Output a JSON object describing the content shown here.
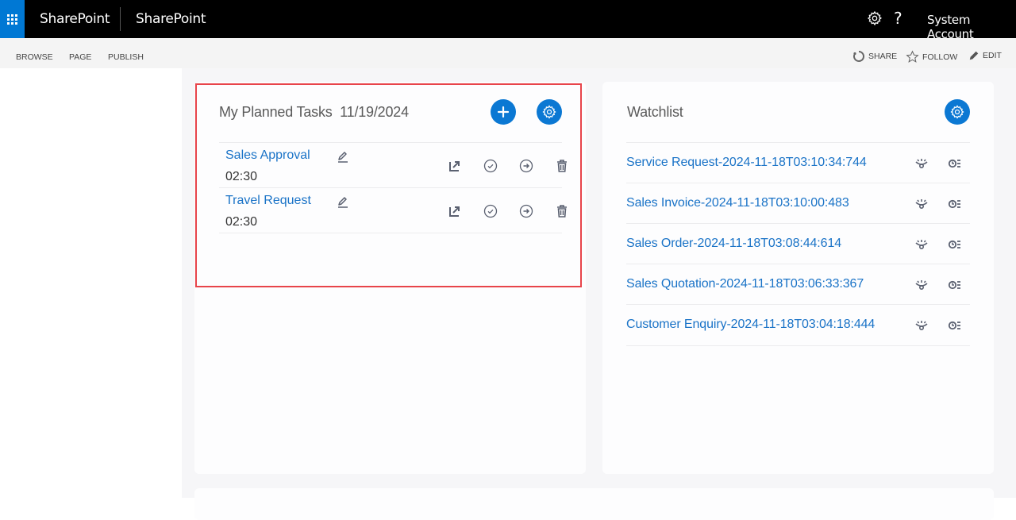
{
  "suitebar": {
    "app_launcher_icon": "waffle-icon",
    "brand": "SharePoint",
    "site_title": "SharePoint",
    "settings_icon": "gear-icon",
    "help_label": "?",
    "user": "System Account"
  },
  "ribbon": {
    "tabs": [
      {
        "label": "BROWSE"
      },
      {
        "label": "PAGE"
      },
      {
        "label": "PUBLISH"
      }
    ],
    "actions": [
      {
        "label": "SHARE",
        "icon": "share-icon"
      },
      {
        "label": "FOLLOW",
        "icon": "star-icon"
      },
      {
        "label": "EDIT",
        "icon": "pencil-icon"
      }
    ]
  },
  "planned_tasks": {
    "title": "My Planned Tasks",
    "date": "11/19/2024",
    "add_icon": "plus-icon",
    "settings_icon": "gear-icon",
    "tasks": [
      {
        "name": "Sales Approval",
        "time": "02:30"
      },
      {
        "name": "Travel Request",
        "time": "02:30"
      }
    ],
    "row_actions": [
      "open-external-icon",
      "check-circle-icon",
      "arrow-right-circle-icon",
      "trash-icon"
    ]
  },
  "watchlist": {
    "title": "Watchlist",
    "settings_icon": "gear-icon",
    "items": [
      {
        "name": "Service Request-2024-11-18T03:10:34:744"
      },
      {
        "name": "Sales Invoice-2024-11-18T03:10:00:483"
      },
      {
        "name": "Sales Order-2024-11-18T03:08:44:614"
      },
      {
        "name": "Sales Quotation-2024-11-18T03:06:33:367"
      },
      {
        "name": "Customer Enquiry-2024-11-18T03:04:18:444"
      }
    ],
    "row_actions": [
      "unwatch-eye-icon",
      "history-list-icon"
    ]
  },
  "colors": {
    "accent": "#0b78d3",
    "link": "#1a73c7",
    "highlight_border": "#e8444a",
    "suitebar": "#000000"
  }
}
